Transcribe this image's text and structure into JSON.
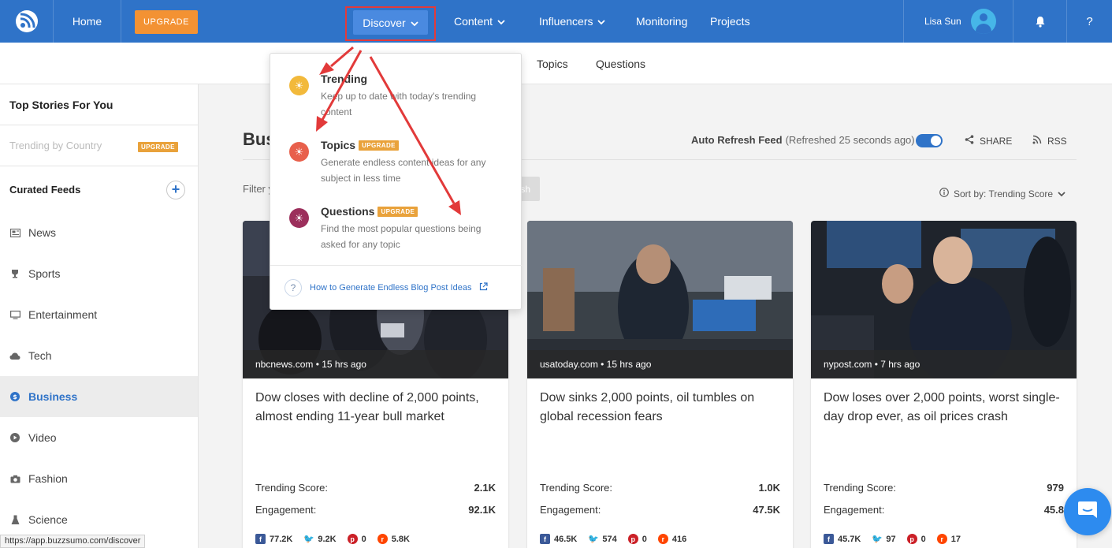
{
  "header": {
    "home_label": "Home",
    "upgrade_label": "UPGRADE",
    "discover_label": "Discover",
    "content_label": "Content",
    "influencers_label": "Influencers",
    "monitoring_label": "Monitoring",
    "projects_label": "Projects",
    "user_name": "Lisa Sun",
    "help_label": "?"
  },
  "subnav": {
    "tabs": [
      "Topics",
      "Questions"
    ]
  },
  "sidebar": {
    "top_stories": "Top Stories For You",
    "trending_by_country": "Trending by Country",
    "trending_badge": "UPGRADE",
    "curated_feeds": "Curated Feeds",
    "add_label": "+",
    "items": [
      {
        "label": "News",
        "icon": "newspaper-icon"
      },
      {
        "label": "Sports",
        "icon": "trophy-icon"
      },
      {
        "label": "Entertainment",
        "icon": "monitor-icon"
      },
      {
        "label": "Tech",
        "icon": "cloud-icon"
      },
      {
        "label": "Business",
        "icon": "dollar-icon",
        "active": true
      },
      {
        "label": "Video",
        "icon": "play-icon"
      },
      {
        "label": "Fashion",
        "icon": "camera-icon"
      },
      {
        "label": "Science",
        "icon": "flask-icon"
      }
    ]
  },
  "main": {
    "title_partial": "Bus",
    "auto_refresh_label": "Auto Refresh Feed",
    "auto_refresh_status": "(Refreshed 25 seconds ago)",
    "share_label": "SHARE",
    "rss_label": "RSS",
    "filter_partial": "Filter y",
    "refresh_partial": "sh",
    "sort_label": "Sort by: Trending Score"
  },
  "dropdown": {
    "items": [
      {
        "title": "Trending",
        "badge": "",
        "desc": "Keep up to date with today's trending content",
        "color": "#f2b93b"
      },
      {
        "title": "Topics",
        "badge": "UPGRADE",
        "desc": "Generate endless content ideas for any subject in less time",
        "color": "#e8604c"
      },
      {
        "title": "Questions",
        "badge": "UPGRADE",
        "desc": "Find the most popular questions being asked for any topic",
        "color": "#9c2f5c"
      }
    ],
    "help_link": "How to Generate Endless Blog Post Ideas",
    "help_q": "?"
  },
  "cards": [
    {
      "source": "nbcnews.com • 15 hrs ago",
      "title": "Dow closes with decline of 2,000 points, almost ending 11-year bull market",
      "trending_label": "Trending Score:",
      "trending_value": "2.1K",
      "engagement_label": "Engagement:",
      "engagement_value": "92.1K",
      "facebook": "77.2K",
      "twitter": "9.2K",
      "pinterest": "0",
      "reddit": "5.8K"
    },
    {
      "source": "usatoday.com • 15 hrs ago",
      "title": "Dow sinks 2,000 points, oil tumbles on global recession fears",
      "trending_label": "Trending Score:",
      "trending_value": "1.0K",
      "engagement_label": "Engagement:",
      "engagement_value": "47.5K",
      "facebook": "46.5K",
      "twitter": "574",
      "pinterest": "0",
      "reddit": "416"
    },
    {
      "source": "nypost.com • 7 hrs ago",
      "title": "Dow loses over 2,000 points, worst single-day drop ever, as oil prices crash",
      "trending_label": "Trending Score:",
      "trending_value": "979",
      "engagement_label": "Engagement:",
      "engagement_value": "45.8",
      "facebook": "45.7K",
      "twitter": "97",
      "pinterest": "0",
      "reddit": "17"
    }
  ],
  "statusbar": {
    "url": "https://app.buzzsumo.com/discover"
  },
  "colors": {
    "brand_blue": "#2f73c8",
    "upgrade_orange": "#f39233",
    "badge_gold": "#e9a23b",
    "highlight_red": "#e23a3a"
  }
}
